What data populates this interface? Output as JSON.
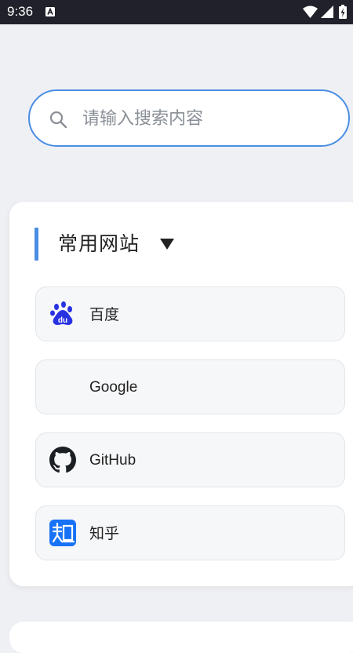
{
  "status_bar": {
    "time": "9:36",
    "icons": [
      "app-notification-icon",
      "wifi-icon",
      "signal-icon",
      "battery-charging-icon"
    ]
  },
  "search": {
    "placeholder": "请输入搜索内容",
    "icon": "search-icon"
  },
  "favorites": {
    "title": "常用网站",
    "toggle_icon": "caret-down-icon",
    "items": [
      {
        "label": "百度",
        "icon": "baidu-logo-icon"
      },
      {
        "label": "Google",
        "icon": ""
      },
      {
        "label": "GitHub",
        "icon": "github-logo-icon"
      },
      {
        "label": "知乎",
        "icon": "zhihu-logo-icon"
      }
    ]
  },
  "colors": {
    "accent": "#4a8ee3",
    "background": "#eff0f4",
    "status_bar": "#21212b",
    "card": "#ffffff",
    "item_background": "#f6f7f9",
    "baidu_blue": "#2932e1",
    "zhihu_blue": "#1772f6"
  }
}
